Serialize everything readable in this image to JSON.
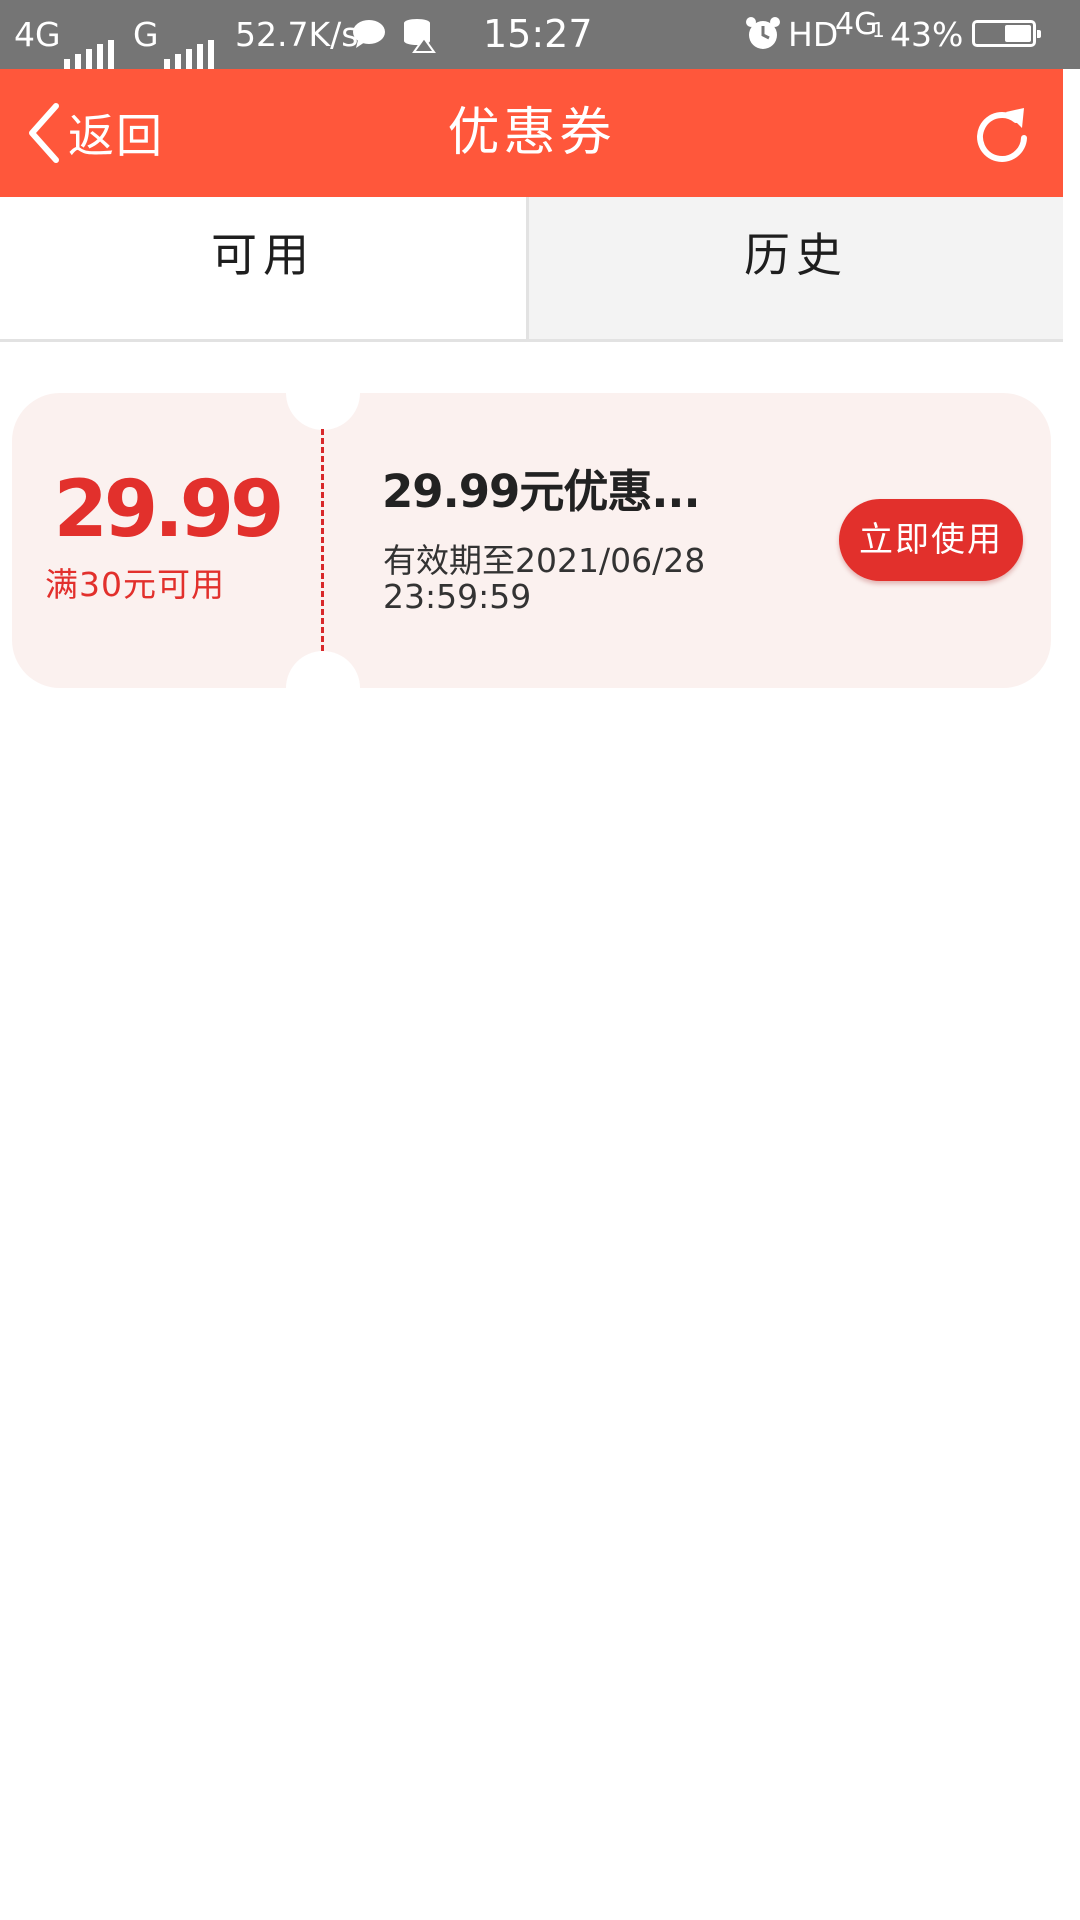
{
  "status_bar": {
    "network_1": "4G",
    "network_2": "G",
    "speed": "52.7K/s",
    "time": "15:27",
    "hd": "HD",
    "network_3": "4G",
    "sim": "1",
    "battery": "43%",
    "battery_level": 0.43,
    "icons": [
      "signal-icon",
      "chat-bubble-icon",
      "database-alert-icon",
      "alarm-icon",
      "battery-charging-icon"
    ]
  },
  "header": {
    "back_label": "返回",
    "title": "优惠券",
    "background_color": "#ff573b",
    "icons": [
      "chevron-left-icon",
      "refresh-icon"
    ]
  },
  "tabs": [
    {
      "label": "可用",
      "active": true
    },
    {
      "label": "历史",
      "active": false
    }
  ],
  "coupons": [
    {
      "amount": "29.99",
      "condition": "满30元可用",
      "title": "29.99元优惠...",
      "expiry_line1": "有效期至2021/06/28",
      "expiry_line2": "23:59:59",
      "button_label": "立即使用",
      "accent_color": "#e2302c"
    }
  ]
}
